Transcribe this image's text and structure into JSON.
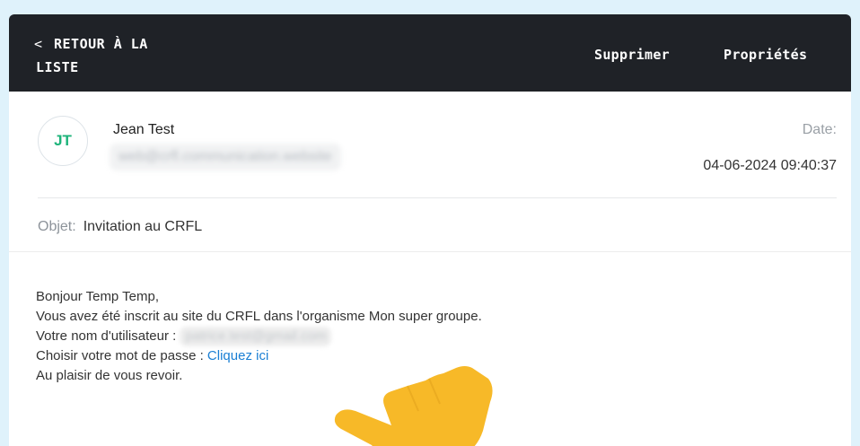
{
  "topbar": {
    "back_line1": "RETOUR À LA",
    "back_line2": "LISTE",
    "delete_label": "Supprimer",
    "properties_label": "Propriétés"
  },
  "sender": {
    "initials": "JT",
    "name": "Jean Test",
    "email": "web@crfl.communication.website",
    "date_label": "Date:",
    "date": "04-06-2024 09:40:37"
  },
  "subject": {
    "label": "Objet:",
    "value": "Invitation au CRFL"
  },
  "message": {
    "greeting": "Bonjour Temp Temp,",
    "line2": "Vous avez été inscrit au site du CRFL dans l'organisme Mon super groupe.",
    "username_label": "Votre nom d'utilisateur :",
    "username_value": "patrice.test@gmail.com",
    "password_label": "Choisir votre mot de passe :",
    "password_link": "Cliquez ici",
    "closing": "Au plaisir de vous revoir."
  },
  "colors": {
    "topbar_bg": "#1f2227",
    "avatar_text": "#1db37a",
    "link": "#1a7fd4",
    "page_bg": "#dff2fb",
    "hand_overlay": "#f7b928"
  },
  "icons": {
    "back": "chevron-left-icon",
    "overlay": "pointing-hand-icon"
  }
}
